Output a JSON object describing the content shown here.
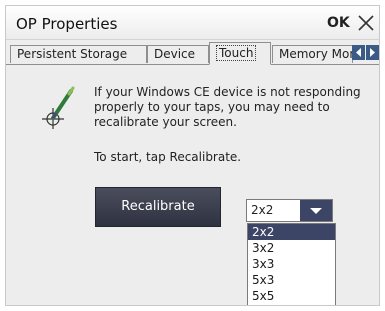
{
  "window": {
    "title": "OP Properties",
    "ok_label": "OK"
  },
  "tabs": [
    {
      "label": "Persistent Storage",
      "active": false
    },
    {
      "label": "Device",
      "active": false
    },
    {
      "label": "Touch",
      "active": true
    },
    {
      "label": "Memory Monitoring",
      "active": false
    }
  ],
  "touch": {
    "message": "If your Windows CE device is not responding properly to your taps, you may need to recalibrate your screen.",
    "start_text": "To start, tap Recalibrate.",
    "recalibrate_label": "Recalibrate",
    "grid_select": {
      "value": "2x2",
      "options": [
        "2x2",
        "3x2",
        "3x3",
        "5x3",
        "5x5"
      ],
      "highlighted": "2x2"
    }
  },
  "icons": {
    "pen": "stylus-crosshair-icon",
    "close": "close-icon",
    "tab_left": "tab-scroll-left-icon",
    "tab_right": "tab-scroll-right-icon",
    "dropdown": "chevron-down-icon"
  },
  "colors": {
    "button_dark": "#2f3341",
    "selection": "#3c4566",
    "tab_arrow": "#3b5a86"
  }
}
